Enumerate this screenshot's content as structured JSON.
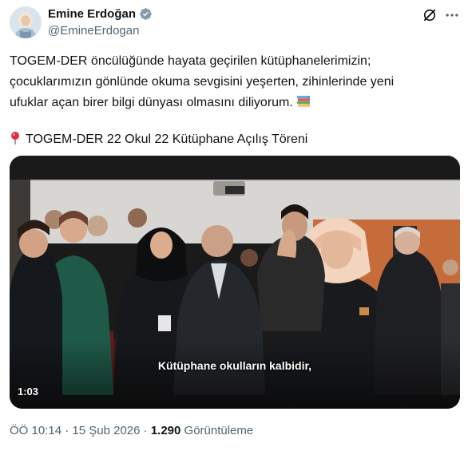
{
  "author": {
    "display_name": "Emine Erdoğan",
    "handle": "@EmineErdogan",
    "avatar_icon": "profile-photo",
    "verified_icon": "verified-badge-icon",
    "verified_color": "#1d9bf0"
  },
  "tweet": {
    "line1": "TOGEM-DER öncülüğünde hayata geçirilen kütüphanelerimizin;",
    "line2": "çocuklarımızın gönlünde okuma sevgisini yeşerten, zihinlerinde yeni",
    "line3": "ufuklar açan birer bilgi dünyası olmasını diliyorum.",
    "line3_emoji_icon": "books-icon",
    "location_icon": "round-pushpin-icon",
    "line4": "TOGEM-DER 22 Okul 22 Kütüphane Açılış Töreni"
  },
  "video": {
    "subtitle": "Kütüphane okulların kalbidir,",
    "duration": "1:03"
  },
  "meta": {
    "time": "ÖÖ 10:14",
    "separator1": " · ",
    "date": "15 Şub 2026",
    "separator2": " · ",
    "views_count": "1.290",
    "views_label": " Görüntüleme"
  },
  "icons": {
    "grok": "grok-icon",
    "more": "more-options-icon"
  }
}
